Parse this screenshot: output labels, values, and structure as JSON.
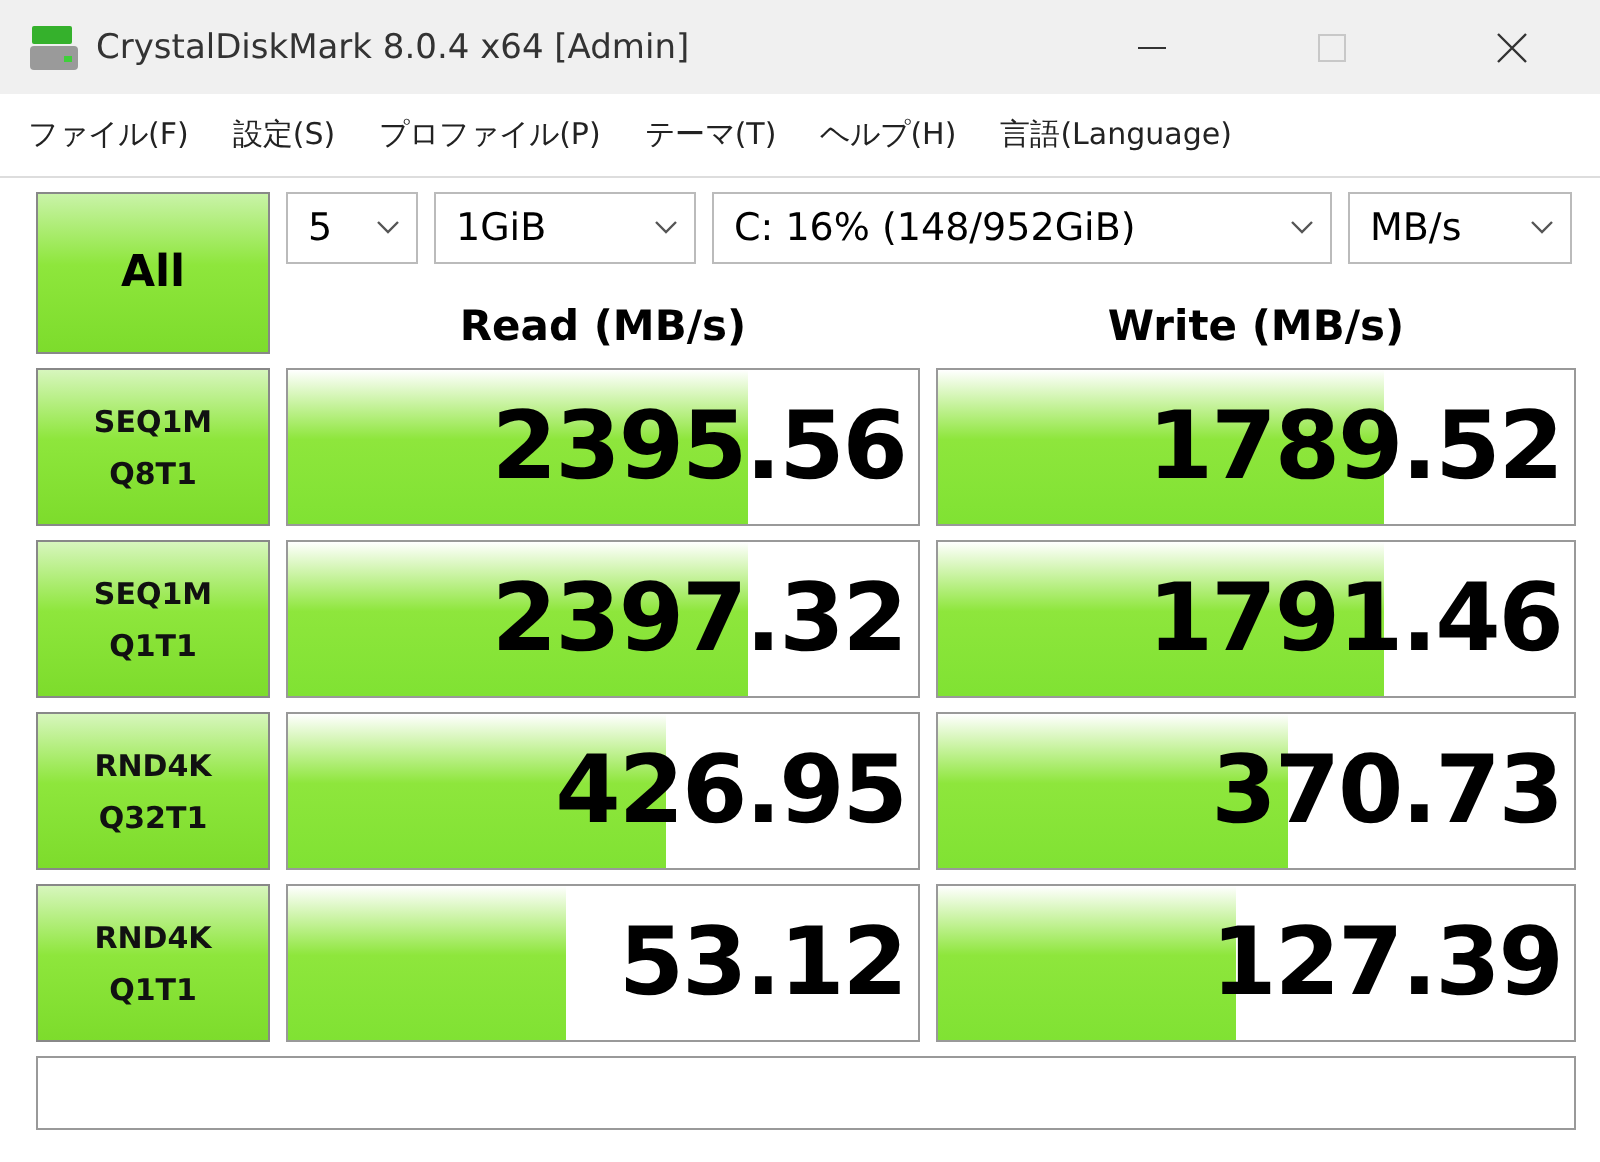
{
  "window": {
    "title": "CrystalDiskMark 8.0.4 x64 [Admin]"
  },
  "menu": [
    "ファイル(F)",
    "設定(S)",
    "プロファイル(P)",
    "テーマ(T)",
    "ヘルプ(H)",
    "言語(Language)"
  ],
  "settings": [
    {
      "value": "5"
    },
    {
      "value": "1GiB"
    },
    {
      "value": "C: 16% (148/952GiB)"
    },
    {
      "value": "MB/s"
    }
  ],
  "all_button": "All",
  "columns": [
    "Read (MB/s)",
    "Write (MB/s)"
  ],
  "tests": [
    {
      "label": [
        "SEQ1M",
        "Q8T1"
      ],
      "read": {
        "value": "2395.56",
        "level": 0.73
      },
      "write": {
        "value": "1789.52",
        "level": 0.7
      }
    },
    {
      "label": [
        "SEQ1M",
        "Q1T1"
      ],
      "read": {
        "value": "2397.32",
        "level": 0.73
      },
      "write": {
        "value": "1791.46",
        "level": 0.7
      }
    },
    {
      "label": [
        "RND4K",
        "Q32T1"
      ],
      "read": {
        "value": "426.95",
        "level": 0.6
      },
      "write": {
        "value": "370.73",
        "level": 0.55
      }
    },
    {
      "label": [
        "RND4K",
        "Q1T1"
      ],
      "read": {
        "value": "53.12",
        "level": 0.44
      },
      "write": {
        "value": "127.39",
        "level": 0.47
      }
    }
  ]
}
